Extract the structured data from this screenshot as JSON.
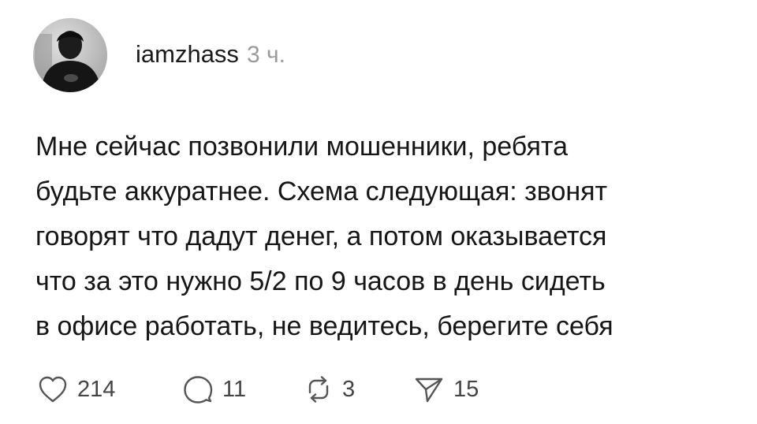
{
  "post": {
    "author": {
      "username": "iamzhass",
      "time": "3 ч."
    },
    "text_lines": [
      "Мне сейчас позвонили мошенники, ребята",
      "будьте аккуратнее. Схема следующая: звонят",
      "говорят что дадут денег, а потом оказывается",
      "что за это нужно 5/2 по 9 часов в день сидеть",
      "в офисе работать, не ведитесь, берегите себя"
    ],
    "actions": {
      "likes": "214",
      "comments": "11",
      "reposts": "3",
      "shares": "15"
    }
  },
  "icons": {
    "like": "heart-icon",
    "comment": "speech-bubble-icon",
    "repost": "repost-arrows-icon",
    "share": "paper-plane-icon"
  }
}
